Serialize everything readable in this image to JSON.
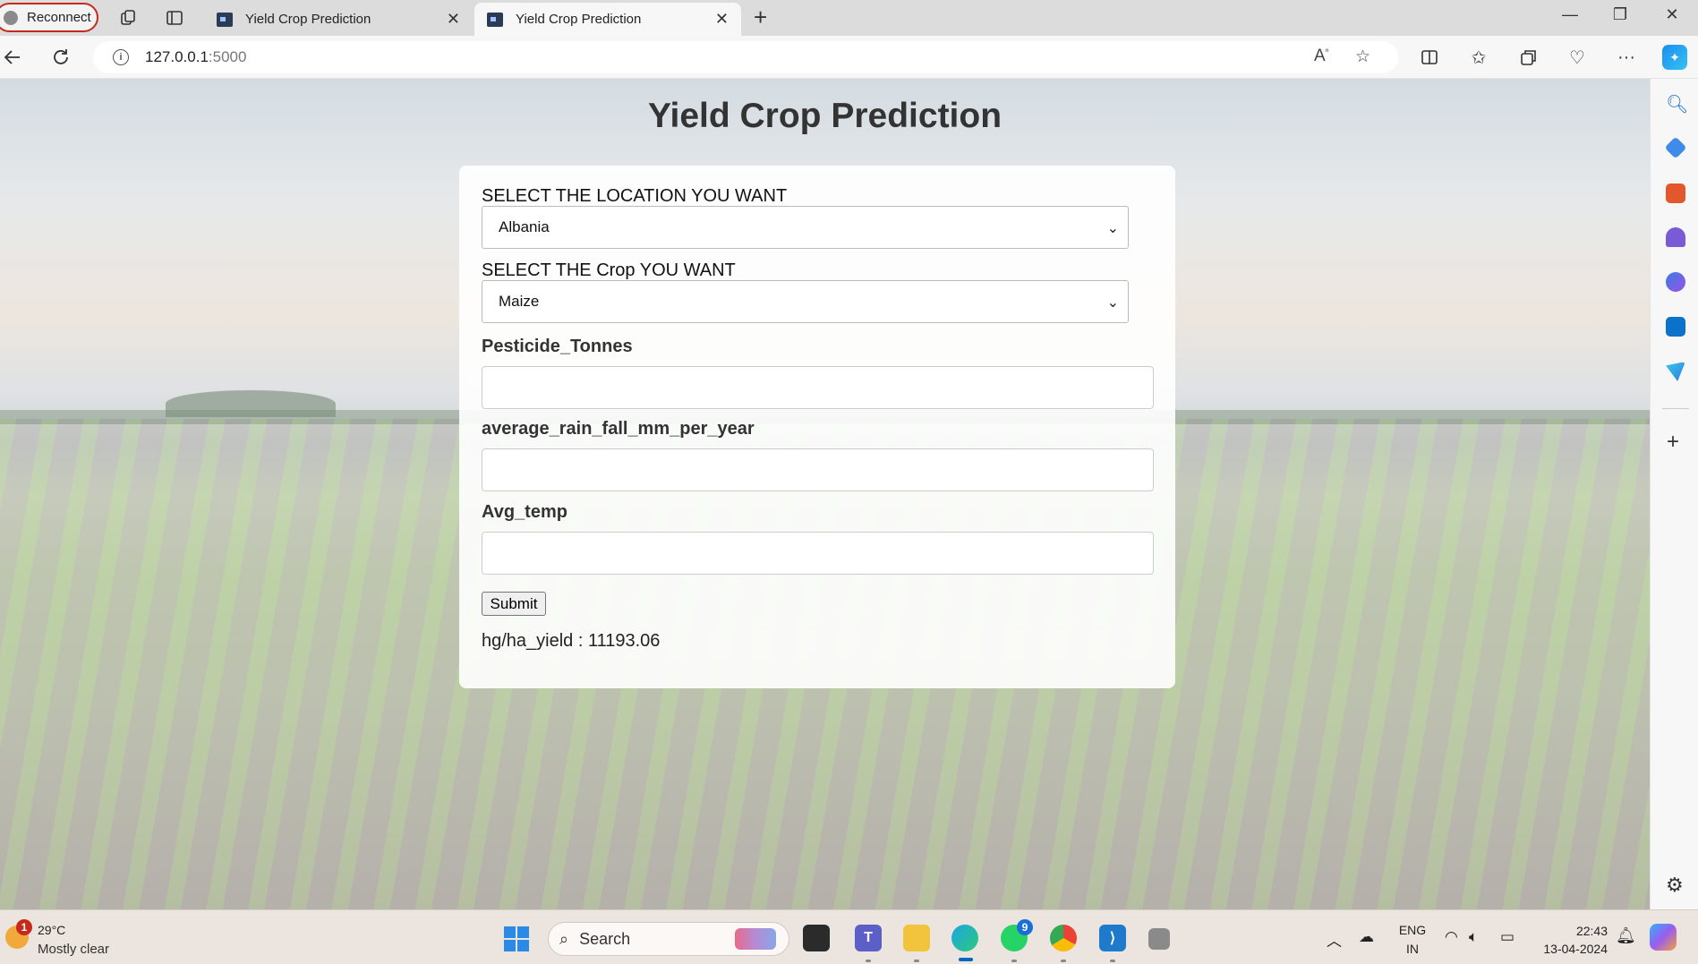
{
  "browser": {
    "profile_label": "Reconnect",
    "tabs": [
      {
        "title": "Yield Crop Prediction",
        "active": false
      },
      {
        "title": "Yield Crop Prediction",
        "active": true
      }
    ],
    "new_tab_symbol": "+",
    "url_host": "127.0.0.1",
    "url_port": ":5000"
  },
  "page": {
    "title": "Yield Crop Prediction",
    "location_label": "SELECT THE LOCATION YOU WANT",
    "location_value": "Albania",
    "crop_label": "SELECT THE Crop YOU WANT",
    "crop_value": "Maize",
    "pesticide_label": "Pesticide_Tonnes",
    "pesticide_value": "",
    "rain_label": "average_rain_fall_mm_per_year",
    "rain_value": "",
    "temp_label": "Avg_temp",
    "temp_value": "",
    "submit_label": "Submit",
    "result_text": "hg/ha_yield : 11193.06"
  },
  "taskbar": {
    "weather_badge": "1",
    "weather_temp": "29°C",
    "weather_desc": "Mostly clear",
    "search_label": "Search",
    "whatsapp_badge": "9",
    "lang_top": "ENG",
    "lang_bottom": "IN",
    "time": "22:43",
    "date": "13-04-2024"
  },
  "colors": {
    "accent": "#0067c0",
    "profile_border": "#c42b1c",
    "title_text": "#333333"
  },
  "icons": [
    "workspaces-icon",
    "tab-actions-icon",
    "back-icon",
    "refresh-icon",
    "site-info-icon",
    "read-aloud-icon",
    "favorite-star-icon",
    "split-screen-icon",
    "favorites-icon",
    "collections-icon",
    "browser-essentials-icon",
    "more-icon",
    "copilot-icon",
    "search-sidebar-icon",
    "shopping-icon",
    "tools-icon",
    "games-icon",
    "office-icon",
    "outlook-icon",
    "drop-icon",
    "add-sidebar-icon",
    "settings-icon"
  ]
}
